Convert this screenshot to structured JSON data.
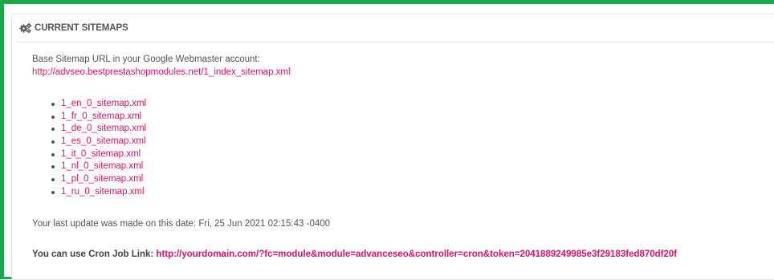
{
  "panel": {
    "title": "CURRENT SITEMAPS",
    "icon": "gears-icon"
  },
  "base": {
    "label": "Base Sitemap URL in your Google Webmaster account:",
    "url": "http://advseo.bestprestashopmodules.net/1_index_sitemap.xml"
  },
  "sitemaps": [
    "1_en_0_sitemap.xml",
    "1_fr_0_sitemap.xml",
    "1_de_0_sitemap.xml",
    "1_es_0_sitemap.xml",
    "1_it_0_sitemap.xml",
    "1_nl_0_sitemap.xml",
    "1_pl_0_sitemap.xml",
    "1_ru_0_sitemap.xml"
  ],
  "last_update": "Your last update was made on this date: Fri, 25 Jun 2021 02:15:43 -0400",
  "cron": {
    "label": "You can use Cron Job Link:",
    "url": "http://yourdomain.com/?fc=module&module=advanceseo&controller=cron&token=2041889249985e3f29183fed870df20f"
  },
  "colors": {
    "link": "#e0116a",
    "text": "#555555",
    "frame": "#19a84a"
  }
}
